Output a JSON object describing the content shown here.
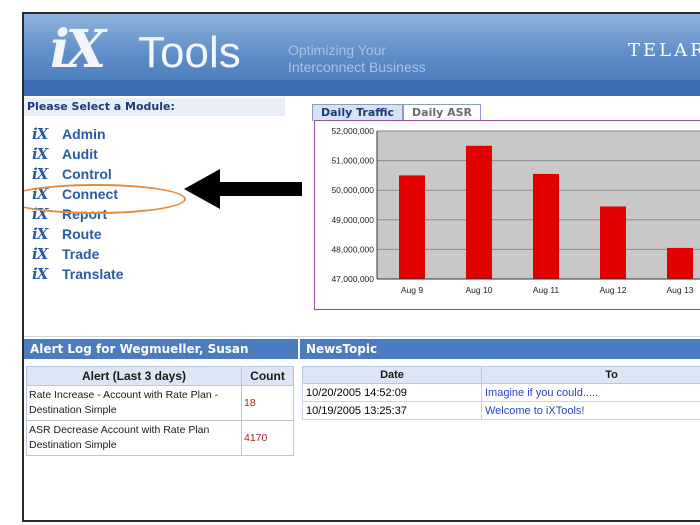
{
  "header": {
    "logo_ix": "iX",
    "logo_tools": "Tools",
    "tagline_line1": "Optimizing Your",
    "tagline_line2": "Interconnect Business",
    "brand": "TELAR"
  },
  "modules": {
    "heading": "Please Select a Module:",
    "icon_text": "iX",
    "items": [
      {
        "label": "Admin"
      },
      {
        "label": "Audit"
      },
      {
        "label": "Control"
      },
      {
        "label": "Connect"
      },
      {
        "label": "Report"
      },
      {
        "label": "Route"
      },
      {
        "label": "Trade"
      },
      {
        "label": "Translate"
      }
    ]
  },
  "tabs": [
    {
      "label": "Daily Traffic",
      "active": true
    },
    {
      "label": "Daily ASR",
      "active": false
    }
  ],
  "chart_data": {
    "type": "bar",
    "categories": [
      "Aug 9",
      "Aug 10",
      "Aug 11",
      "Aug 12",
      "Aug 13"
    ],
    "values": [
      50500000,
      51500000,
      50550000,
      49450000,
      48050000
    ],
    "yticks": [
      "52,000,000",
      "51,000,000",
      "50,000,000",
      "49,000,000",
      "48,000,000",
      "47,000,000"
    ],
    "ylim": [
      47000000,
      52000000
    ],
    "bar_color": "#e00000",
    "plot_bg": "#c8c8c8",
    "grid": true
  },
  "alert_log": {
    "title": "Alert Log for Wegmueller, Susan",
    "col_alert": "Alert (Last 3 days)",
    "col_count": "Count",
    "rows": [
      {
        "alert": "Rate Increase - Account with Rate Plan - Destination Simple",
        "count": "18"
      },
      {
        "alert": "ASR Decrease Account with Rate Plan Destination Simple",
        "count": "4170"
      }
    ]
  },
  "news": {
    "title": "NewsTopic",
    "col_date": "Date",
    "col_topic": "To",
    "rows": [
      {
        "date": "10/20/2005 14:52:09",
        "topic": "Imagine if you could....."
      },
      {
        "date": "10/19/2005 13:25:37",
        "topic": "Welcome to iXTools!"
      }
    ]
  }
}
